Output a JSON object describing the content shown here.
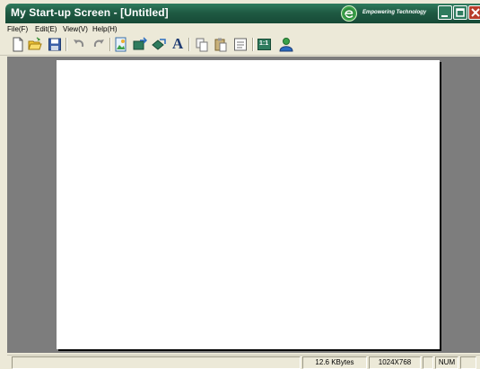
{
  "window": {
    "title": "My Start-up Screen - [Untitled]",
    "brand_tagline": "Empowering Technology",
    "titlebar_color": "#1f5a43"
  },
  "menu": [
    {
      "label": "File(F)"
    },
    {
      "label": "Edit(E)"
    },
    {
      "label": "View(V)"
    },
    {
      "label": "Help(H)"
    }
  ],
  "toolbar": {
    "tools": [
      "new-file-icon",
      "open-folder-icon",
      "save-icon",
      "undo-icon",
      "redo-icon",
      "import-image-icon",
      "export-image-icon",
      "image-edit-icon",
      "text-tool-icon",
      "copy-icon",
      "paste-icon",
      "properties-icon",
      "actual-size-icon",
      "user-icon"
    ],
    "text_tool_glyph": "A",
    "actual_size_label": "1:1"
  },
  "status": {
    "file_size": "12.6 KBytes",
    "resolution": "1024X768",
    "num_lock": "NUM"
  }
}
